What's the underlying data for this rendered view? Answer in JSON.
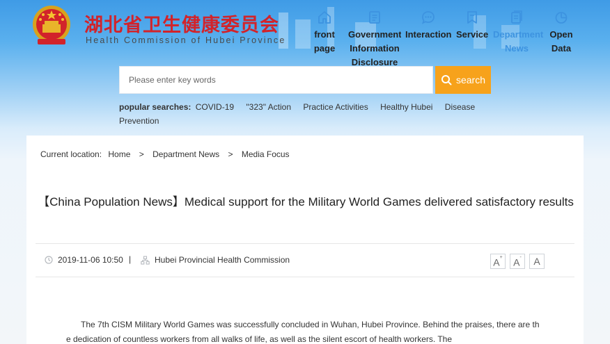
{
  "header": {
    "title_cn": "湖北省卫生健康委员会",
    "title_en": "Health Commission of Hubei Province"
  },
  "nav": {
    "items": [
      {
        "label": "front page",
        "icon": "home-icon"
      },
      {
        "label": "Government Information Disclosure",
        "icon": "document-icon"
      },
      {
        "label": "Interaction",
        "icon": "chat-icon"
      },
      {
        "label": "Service",
        "icon": "bookmark-icon"
      },
      {
        "label": "Department News",
        "icon": "news-icon",
        "active": true
      },
      {
        "label": "Open Data",
        "icon": "pie-chart-icon"
      }
    ],
    "active_color": "#3d93e0"
  },
  "search": {
    "placeholder": "Please enter key words",
    "value": "",
    "button_label": "search",
    "button_color": "#f7a21b"
  },
  "popular_searches": {
    "label": "popular searches:",
    "items": [
      "COVID-19",
      "\"323\" Action",
      "Practice Activities",
      "Healthy Hubei",
      "Disease Prevention"
    ]
  },
  "breadcrumb": {
    "label": "Current location:",
    "items": [
      "Home",
      "Department News",
      "Media Focus"
    ],
    "separator": ">"
  },
  "article": {
    "title": "【China Population News】Medical support for the Military World Games delivered satisfactory results",
    "date": "2019-11-06 10:50",
    "meta_separator": "|",
    "source": "Hubei Provincial Health Commission",
    "font_size_buttons": [
      "A",
      "A",
      "A"
    ],
    "body": "The 7th CISM Military World Games was successfully concluded in Wuhan, Hubei Province. Behind the praises, there are the dedication of countless workers from all walks of life, as well as the silent escort of health workers. The"
  }
}
